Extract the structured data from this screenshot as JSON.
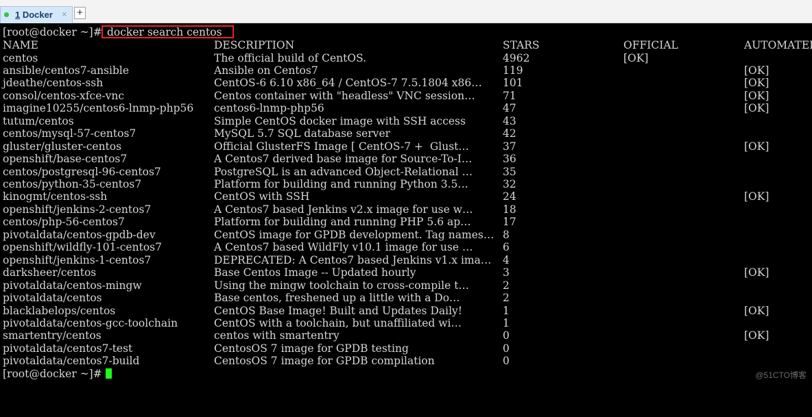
{
  "tab": {
    "number": "1",
    "title": " Docker",
    "close": "×"
  },
  "newtab": "+",
  "prompt": "[root@docker ~]# ",
  "command": "docker search centos",
  "headers": {
    "name": "NAME",
    "description": "DESCRIPTION",
    "stars": "STARS",
    "official": "OFFICIAL",
    "automated": "AUTOMATED"
  },
  "rows": [
    {
      "name": "centos",
      "description": "The official build of CentOS.",
      "stars": "4962",
      "official": "[OK]",
      "automated": ""
    },
    {
      "name": "ansible/centos7-ansible",
      "description": "Ansible on Centos7",
      "stars": "119",
      "official": "",
      "automated": "[OK]"
    },
    {
      "name": "jdeathe/centos-ssh",
      "description": "CentOS-6 6.10 x86_64 / CentOS-7 7.5.1804 x86…",
      "stars": "101",
      "official": "",
      "automated": "[OK]"
    },
    {
      "name": "consol/centos-xfce-vnc",
      "description": "Centos container with \"headless\" VNC session…",
      "stars": "71",
      "official": "",
      "automated": "[OK]"
    },
    {
      "name": "imagine10255/centos6-lnmp-php56",
      "description": "centos6-lnmp-php56",
      "stars": "47",
      "official": "",
      "automated": "[OK]"
    },
    {
      "name": "tutum/centos",
      "description": "Simple CentOS docker image with SSH access",
      "stars": "43",
      "official": "",
      "automated": ""
    },
    {
      "name": "centos/mysql-57-centos7",
      "description": "MySQL 5.7 SQL database server",
      "stars": "42",
      "official": "",
      "automated": ""
    },
    {
      "name": "gluster/gluster-centos",
      "description": "Official GlusterFS Image [ CentOS-7 +  Glust…",
      "stars": "37",
      "official": "",
      "automated": "[OK]"
    },
    {
      "name": "openshift/base-centos7",
      "description": "A Centos7 derived base image for Source-To-I…",
      "stars": "36",
      "official": "",
      "automated": ""
    },
    {
      "name": "centos/postgresql-96-centos7",
      "description": "PostgreSQL is an advanced Object-Relational …",
      "stars": "35",
      "official": "",
      "automated": ""
    },
    {
      "name": "centos/python-35-centos7",
      "description": "Platform for building and running Python 3.5…",
      "stars": "32",
      "official": "",
      "automated": ""
    },
    {
      "name": "kinogmt/centos-ssh",
      "description": "CentOS with SSH",
      "stars": "24",
      "official": "",
      "automated": "[OK]"
    },
    {
      "name": "openshift/jenkins-2-centos7",
      "description": "A Centos7 based Jenkins v2.x image for use w…",
      "stars": "18",
      "official": "",
      "automated": ""
    },
    {
      "name": "centos/php-56-centos7",
      "description": "Platform for building and running PHP 5.6 ap…",
      "stars": "17",
      "official": "",
      "automated": ""
    },
    {
      "name": "pivotaldata/centos-gpdb-dev",
      "description": "CentOS image for GPDB development. Tag names…",
      "stars": "8",
      "official": "",
      "automated": ""
    },
    {
      "name": "openshift/wildfly-101-centos7",
      "description": "A Centos7 based WildFly v10.1 image for use …",
      "stars": "6",
      "official": "",
      "automated": ""
    },
    {
      "name": "openshift/jenkins-1-centos7",
      "description": "DEPRECATED: A Centos7 based Jenkins v1.x ima…",
      "stars": "4",
      "official": "",
      "automated": ""
    },
    {
      "name": "darksheer/centos",
      "description": "Base Centos Image -- Updated hourly",
      "stars": "3",
      "official": "",
      "automated": "[OK]"
    },
    {
      "name": "pivotaldata/centos-mingw",
      "description": "Using the mingw toolchain to cross-compile t…",
      "stars": "2",
      "official": "",
      "automated": ""
    },
    {
      "name": "pivotaldata/centos",
      "description": "Base centos, freshened up a little with a Do…",
      "stars": "2",
      "official": "",
      "automated": ""
    },
    {
      "name": "blacklabelops/centos",
      "description": "CentOS Base Image! Built and Updates Daily!",
      "stars": "1",
      "official": "",
      "automated": "[OK]"
    },
    {
      "name": "pivotaldata/centos-gcc-toolchain",
      "description": "CentOS with a toolchain, but unaffiliated wi…",
      "stars": "1",
      "official": "",
      "automated": ""
    },
    {
      "name": "smartentry/centos",
      "description": "centos with smartentry",
      "stars": "0",
      "official": "",
      "automated": "[OK]"
    },
    {
      "name": "pivotaldata/centos7-test",
      "description": "CentosOS 7 image for GPDB testing",
      "stars": "0",
      "official": "",
      "automated": ""
    },
    {
      "name": "pivotaldata/centos7-build",
      "description": "CentosOS 7 image for GPDB compilation",
      "stars": "0",
      "official": "",
      "automated": ""
    }
  ],
  "final_prompt": "[root@docker ~]# ",
  "watermark": "@51CTO博客",
  "colors": {
    "background": "#000000",
    "text": "#d6d6d6",
    "cursor": "#1cff1c",
    "highlight_box": "#e8242a",
    "tab_bg": "#d4e8f9"
  }
}
